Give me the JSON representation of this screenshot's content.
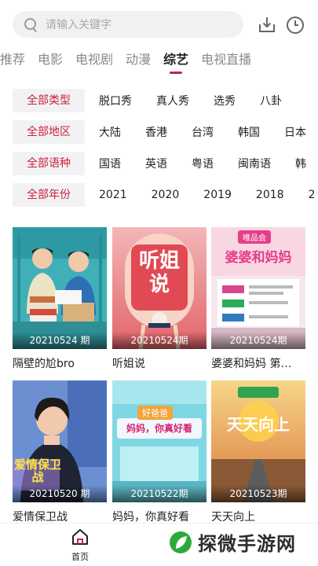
{
  "search": {
    "placeholder": "请输入关键字"
  },
  "toolbar": {
    "download_icon": "download-icon",
    "history_icon": "clock-icon"
  },
  "tabs": [
    {
      "label": "推荐",
      "active": false
    },
    {
      "label": "电影",
      "active": false
    },
    {
      "label": "电视剧",
      "active": false
    },
    {
      "label": "动漫",
      "active": false
    },
    {
      "label": "综艺",
      "active": true
    },
    {
      "label": "电视直播",
      "active": false
    }
  ],
  "filters": {
    "type": {
      "all": "全部类型",
      "options": [
        "脱口秀",
        "真人秀",
        "选秀",
        "八卦"
      ]
    },
    "region": {
      "all": "全部地区",
      "options": [
        "大陆",
        "香港",
        "台湾",
        "韩国",
        "日本"
      ]
    },
    "language": {
      "all": "全部语种",
      "options": [
        "国语",
        "英语",
        "粤语",
        "闽南语",
        "韩"
      ]
    },
    "year": {
      "all": "全部年份",
      "options": [
        "2021",
        "2020",
        "2019",
        "2018",
        "2"
      ]
    }
  },
  "cards": [
    {
      "title": "隔壁的尬bro",
      "episode": "20210524 期"
    },
    {
      "title": "听姐说",
      "episode": "20210524期"
    },
    {
      "title": "婆婆和妈妈 第…",
      "episode": "20210524期"
    },
    {
      "title": "爱情保卫战",
      "episode": "20210520 期"
    },
    {
      "title": "妈妈，你真好看",
      "episode": "20210522期"
    },
    {
      "title": "天天向上",
      "episode": "20210523期"
    }
  ],
  "poster_text": {
    "p2_big": "听姐说",
    "p3_brand": "唯品会",
    "p3_title": "婆婆和妈妈",
    "p4_title": "爱情保卫战",
    "p5_badge": "好爸爸",
    "p5_title": "妈妈，你真好看",
    "p6_title": "天天向上"
  },
  "bottom_nav": {
    "home_label": "首页"
  },
  "watermark": {
    "text": "探微手游网"
  },
  "colors": {
    "accent": "#c8243c",
    "chip_bg": "#f2f2f4",
    "search_bg": "#f1f1f3"
  }
}
